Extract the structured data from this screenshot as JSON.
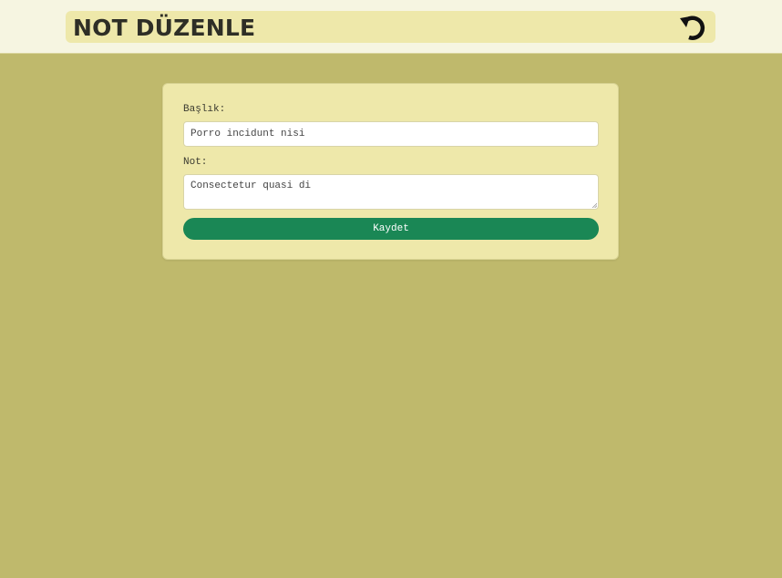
{
  "header": {
    "title": "NOT DÜZENLE",
    "back_icon": "undo-arrow-icon"
  },
  "form": {
    "title_label": "Başlık:",
    "title_value": "Porro incidunt nisi",
    "note_label": "Not:",
    "note_value": "Consectetur quasi di",
    "save_label": "Kaydet"
  },
  "colors": {
    "page_background": "#bfb96c",
    "topbar_background": "#f6f5e1",
    "header_background": "#eee8aa",
    "card_background": "#eee8aa",
    "save_button": "#1a8755"
  }
}
